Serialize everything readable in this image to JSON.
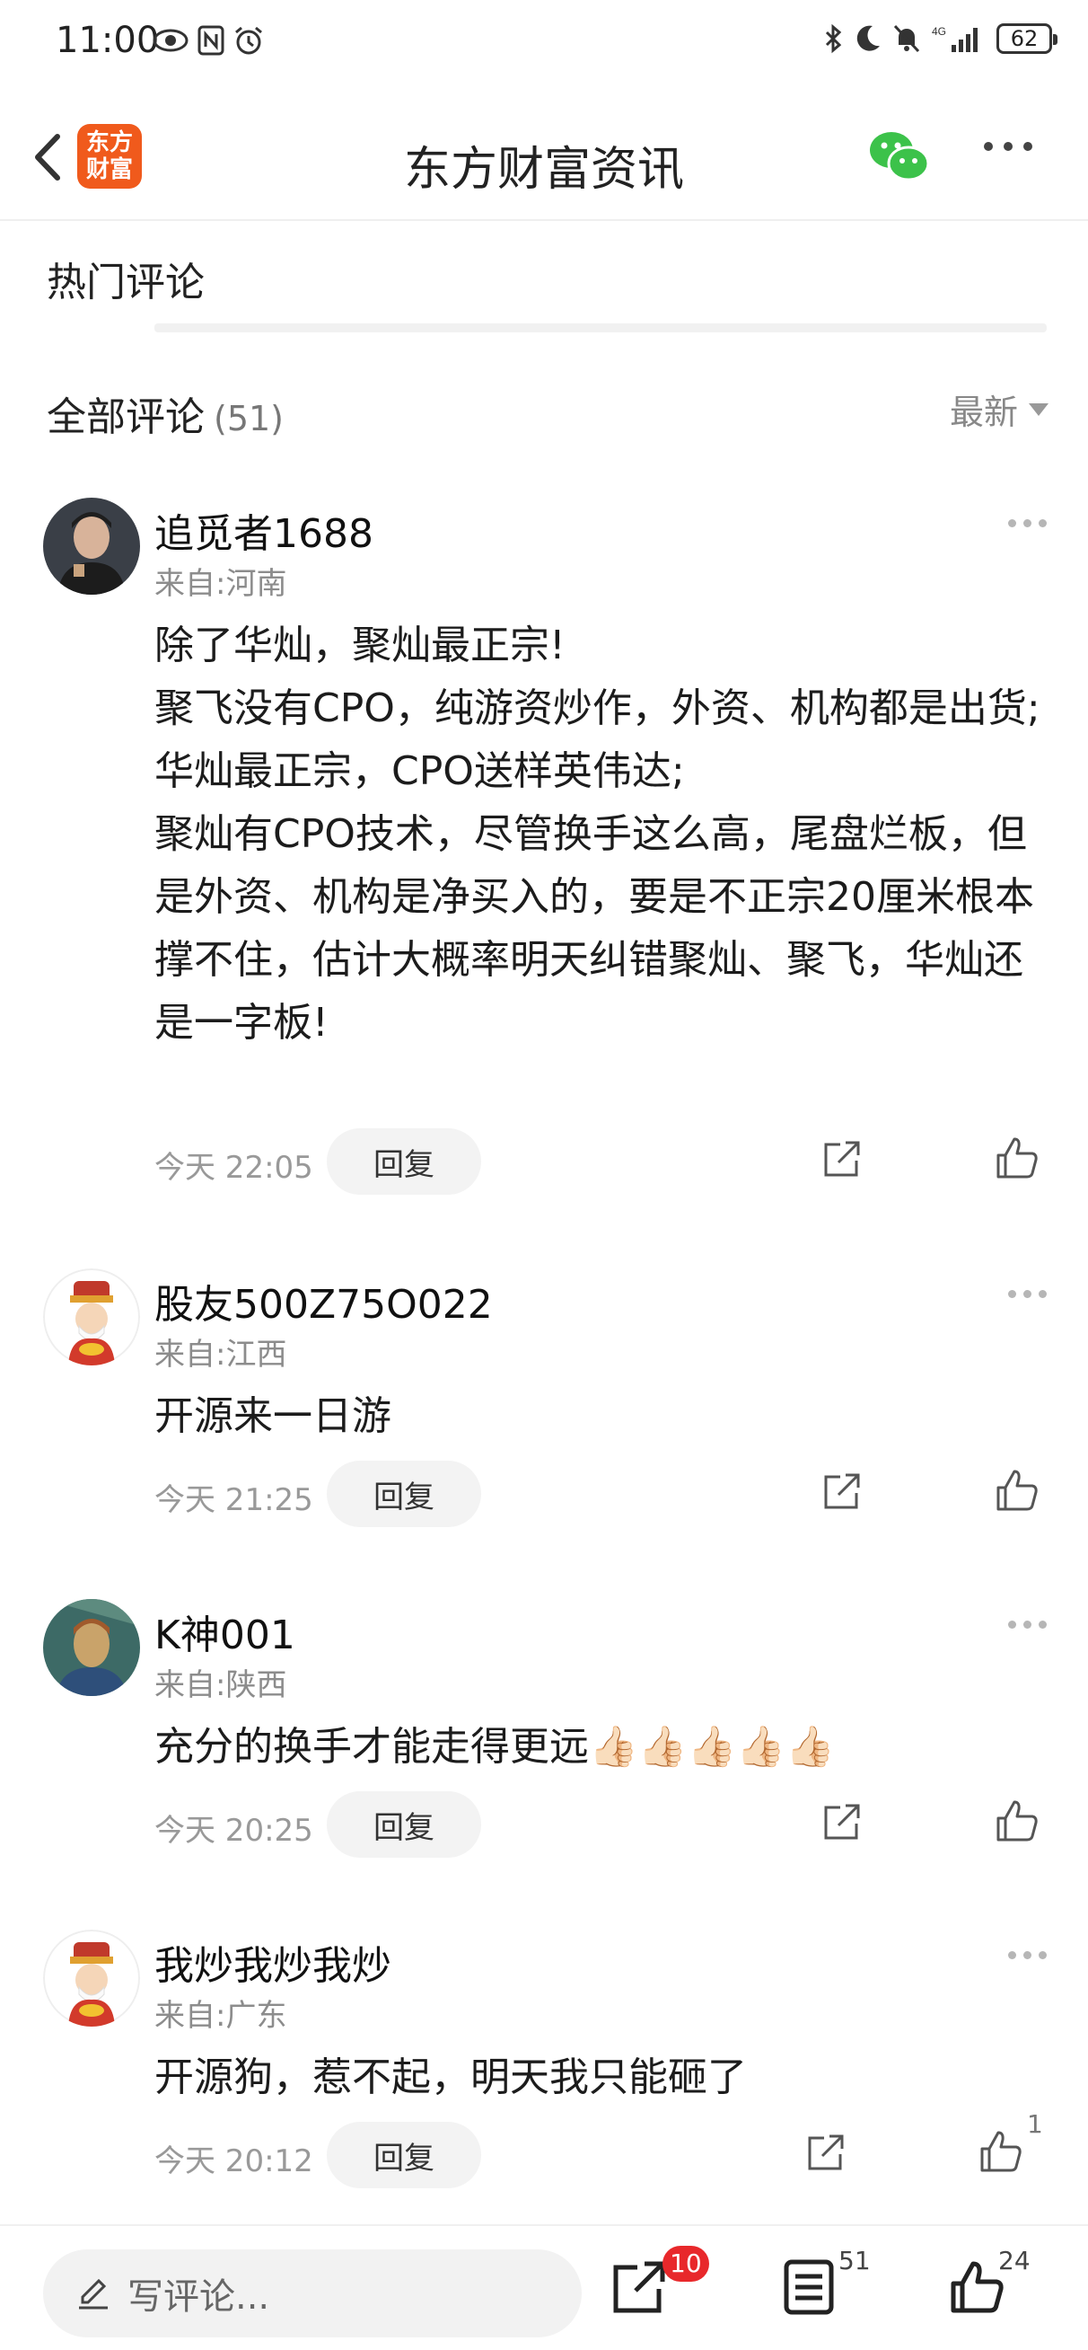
{
  "status_bar": {
    "time": "11:00",
    "battery": "62",
    "network": "4G"
  },
  "nav": {
    "logo_line1": "东方",
    "logo_line2": "财富",
    "title": "东方财富资讯"
  },
  "hot": {
    "title": "热门评论"
  },
  "all": {
    "title": "全部评论",
    "count": "(51)",
    "sort_label": "最新"
  },
  "comments": [
    {
      "user": "追觅者1688",
      "location": "来自:河南",
      "text": "除了华灿，聚灿最正宗!\n聚飞没有CPO，纯游资炒作，外资、机构都是出货;\n华灿最正宗，CPO送样英伟达;\n聚灿有CPO技术，尽管换手这么高，尾盘烂板，但是外资、机构是净买入的，要是不正宗20厘米根本撑不住，估计大概率明天纠错聚灿、聚飞，华灿还是一字板!",
      "time": "今天 22:05",
      "reply": "回复",
      "likes": ""
    },
    {
      "user": "股友500Z75O022",
      "location": "来自:江西",
      "text": "开源来一日游",
      "time": "今天 21:25",
      "reply": "回复",
      "likes": ""
    },
    {
      "user": "K神001",
      "location": "来自:陕西",
      "text": "充分的换手才能走得更远👍🏻👍🏻👍🏻👍🏻👍🏻",
      "time": "今天 20:25",
      "reply": "回复",
      "likes": ""
    },
    {
      "user": "我炒我炒我炒",
      "location": "来自:广东",
      "text": "开源狗，惹不起，明天我只能砸了",
      "time": "今天 20:12",
      "reply": "回复",
      "likes": "1"
    }
  ],
  "bottom": {
    "write_placeholder": "写评论...",
    "share_badge": "10",
    "comment_count": "51",
    "like_count": "24"
  },
  "colors": {
    "brand": "#f05a1c",
    "badge": "#e8282b",
    "wechat": "#3cc24a"
  }
}
